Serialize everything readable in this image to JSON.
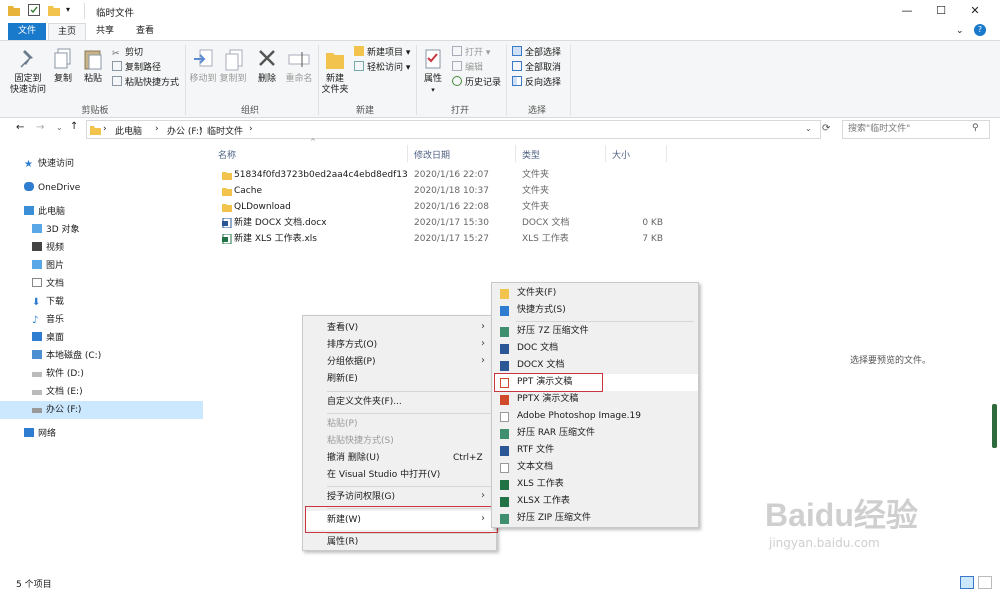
{
  "title": "临时文件",
  "tabs": {
    "file": "文件",
    "home": "主页",
    "share": "共享",
    "view": "查看"
  },
  "ribbon": {
    "pin": "固定到\n快速访问",
    "copy": "复制",
    "paste": "粘贴",
    "cut": "剪切",
    "copy_path": "复制路径",
    "paste_shortcut": "粘贴快捷方式",
    "move_to": "移动到",
    "copy_to": "复制到",
    "delete": "删除",
    "rename": "重命名",
    "new_folder": "新建\n文件夹",
    "new_item": "新建项目",
    "easy_access": "轻松访问",
    "properties": "属性",
    "open": "打开",
    "edit": "编辑",
    "history": "历史记录",
    "select_all": "全部选择",
    "select_none": "全部取消",
    "invert": "反向选择",
    "groups": {
      "clipboard": "剪贴板",
      "organize": "组织",
      "new": "新建",
      "open": "打开",
      "select": "选择"
    }
  },
  "address": {
    "parts": [
      "此电脑",
      "办公 (F:)",
      "临时文件"
    ],
    "search_placeholder": "搜索\"临时文件\""
  },
  "nav": {
    "items": [
      "快速访问",
      "OneDrive",
      "此电脑",
      "3D 对象",
      "视频",
      "图片",
      "文档",
      "下载",
      "音乐",
      "桌面",
      "本地磁盘 (C:)",
      "软件 (D:)",
      "文档 (E:)",
      "办公 (F:)",
      "网络"
    ]
  },
  "columns": {
    "name": "名称",
    "modified": "修改日期",
    "type": "类型",
    "size": "大小"
  },
  "files": [
    {
      "name": "51834f0fd3723b0ed2aa4c4ebd8edf13",
      "date": "2020/1/16 22:07",
      "type": "文件夹",
      "size": ""
    },
    {
      "name": "Cache",
      "date": "2020/1/18 10:37",
      "type": "文件夹",
      "size": ""
    },
    {
      "name": "QLDownload",
      "date": "2020/1/16 22:08",
      "type": "文件夹",
      "size": ""
    },
    {
      "name": "新建 DOCX 文档.docx",
      "date": "2020/1/17 15:30",
      "type": "DOCX 文档",
      "size": "0 KB"
    },
    {
      "name": "新建 XLS 工作表.xls",
      "date": "2020/1/17 15:27",
      "type": "XLS 工作表",
      "size": "7 KB"
    }
  ],
  "context_menu": {
    "items": [
      "查看(V)",
      "排序方式(O)",
      "分组依据(P)",
      "刷新(E)",
      "自定义文件夹(F)...",
      "粘贴(P)",
      "粘贴快捷方式(S)",
      "撤消 删除(U)",
      "在 Visual Studio 中打开(V)",
      "授予访问权限(G)",
      "新建(W)",
      "属性(R)"
    ],
    "undo_shortcut": "Ctrl+Z"
  },
  "submenu": {
    "items": [
      "文件夹(F)",
      "快捷方式(S)",
      "好压 7Z 压缩文件",
      "DOC 文档",
      "DOCX 文档",
      "PPT 演示文稿",
      "PPTX 演示文稿",
      "Adobe Photoshop Image.19",
      "好压 RAR 压缩文件",
      "RTF 文件",
      "文本文档",
      "XLS 工作表",
      "XLSX 工作表",
      "好压 ZIP 压缩文件"
    ]
  },
  "status": "5 个项目",
  "preview_hint": "选择要预览的文件。",
  "watermark": {
    "brand": "Baidu经验",
    "url": "jingyan.baidu.com"
  },
  "colors": {
    "accent": "#1979ca",
    "highlight": "#c8373f",
    "folder": "#f2c44d"
  }
}
